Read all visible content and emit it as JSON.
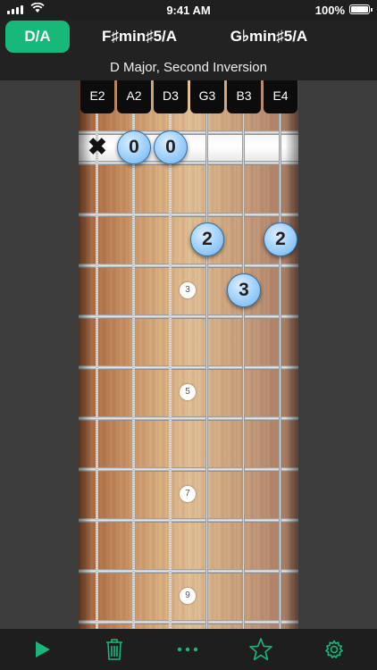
{
  "status_bar": {
    "time": "9:41 AM",
    "battery": "100%"
  },
  "chord_tabs": [
    {
      "label": "D/A",
      "active": true
    },
    {
      "label": "F♯min♯5/A",
      "active": false
    },
    {
      "label": "G♭min♯5/A",
      "active": false
    }
  ],
  "chord_name": "D Major, Second Inversion",
  "strings": [
    "E2",
    "A2",
    "D3",
    "G3",
    "B3",
    "E4"
  ],
  "open_string_markers": [
    {
      "string": "E2",
      "symbol": "✖"
    },
    {
      "string": "A2",
      "finger": "0"
    },
    {
      "string": "D3",
      "finger": "0"
    }
  ],
  "finger_positions": [
    {
      "string": "G3",
      "fret": 2,
      "finger": "2"
    },
    {
      "string": "E4",
      "fret": 2,
      "finger": "2"
    },
    {
      "string": "B3",
      "fret": 3,
      "finger": "3"
    }
  ],
  "fret_inlay_labels": [
    "3",
    "5",
    "7",
    "9"
  ],
  "toolbar": {
    "play": "play-icon",
    "delete": "trash-icon",
    "more": "more-icon",
    "favorite": "star-icon",
    "settings": "gear-icon"
  },
  "colors": {
    "accent": "#17b87a",
    "finger_dot": "#a7d4fb"
  }
}
